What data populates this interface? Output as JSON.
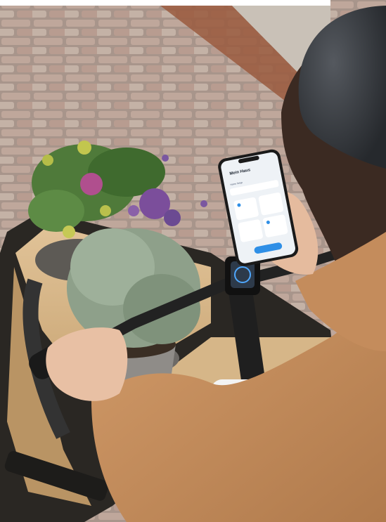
{
  "scene": {
    "description_icons": [
      "bicycle-icon",
      "flower-pot-icon",
      "smartphone-icon",
      "helmet-icon"
    ],
    "colors": {
      "cobblestone": "#b59e92",
      "jacket": "#c48c5c",
      "cargo_box": "#d7b88a",
      "phone_accent": "#2f8fe6",
      "helmet": "#3a3d42"
    }
  },
  "phone_app": {
    "title": "Mein Haus",
    "subtitle": "Home Setup"
  },
  "bike_display": {
    "speed": "0"
  }
}
